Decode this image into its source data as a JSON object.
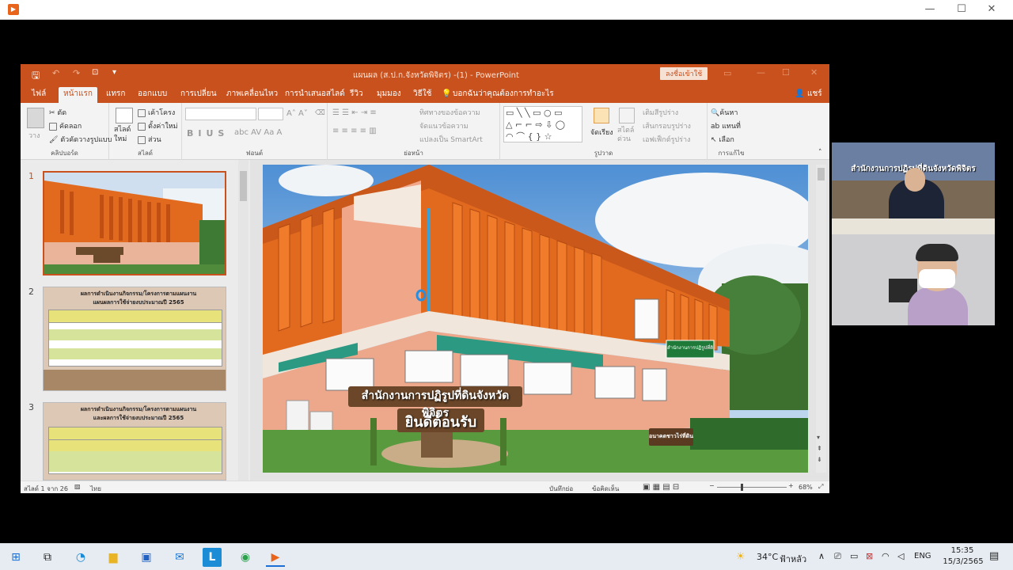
{
  "outer_window": {
    "controls": [
      "—",
      "☐",
      "✕"
    ]
  },
  "ppt": {
    "title": "แผนผล (ส.ป.ก.จังหวัดพิจิตร) -(1) - PowerPoint",
    "signin": "ลงชื่อเข้าใช้",
    "ribbon_tabs": [
      "ไฟล์",
      "หน้าแรก",
      "แทรก",
      "ออกแบบ",
      "การเปลี่ยน",
      "ภาพเคลื่อนไหว",
      "การนำเสนอสไลด์",
      "รีวิว",
      "มุมมอง",
      "วิธีใช้"
    ],
    "tell_me": "บอกฉันว่าคุณต้องการทำอะไร",
    "share": "แชร์",
    "clipboard": {
      "paste": "วาง",
      "cut": "ตัด",
      "copy": "คัดลอก",
      "format_painter": "ตัวคัดวางรูปแบบ",
      "label": "คลิปบอร์ด"
    },
    "slides": {
      "new_slide": "สไลด์ใหม่",
      "layout": "เค้าโครง",
      "reset": "ตั้งค่าใหม่",
      "section": "ส่วน",
      "label": "สไลด์"
    },
    "font": {
      "label": "ฟอนต์"
    },
    "paragraph": {
      "text_direction": "ทิศทางของข้อความ",
      "align_text": "จัดแนวข้อความ",
      "smartart": "แปลงเป็น SmartArt",
      "label": "ย่อหน้า"
    },
    "drawing": {
      "arrange": "จัดเรียง",
      "quick_styles": "สไตล์ด่วน",
      "shape_fill": "เติมสีรูปร่าง",
      "shape_outline": "เส้นกรอบรูปร่าง",
      "shape_effects": "เอฟเฟ็กต์รูปร่าง",
      "label": "รูปวาด"
    },
    "editing": {
      "find": "ค้นหา",
      "replace": "แทนที่",
      "select": "เลือก",
      "label": "การแก้ไข"
    },
    "slide_numbers": [
      "1",
      "2",
      "3"
    ],
    "thumb_titles": {
      "t2a": "ผลการดำเนินงานกิจกรรม/โครงการตามแผนงาน",
      "t2b": "แผนผลการใช้จ่ายงบประมาณปี 2565",
      "t3a": "ผลการดำเนินงานกิจกรรม/โครงการตามแผนงาน",
      "t3b": "และผลการใช้จ่ายงบประมาณปี 2565"
    },
    "slide": {
      "sign_line1": "สำนักงานการปฏิรูปที่ดินจังหวัดพิจิตร",
      "sign_line2": "ยินดีต้อนรับ",
      "building_sign": "สำนักงานการปฏิรูปที่ดินจังหวัดพิจิตร",
      "small_sign": "อนาคตชาวไร่ที่ดิน"
    },
    "status": {
      "slide_of": "สไลด์ 1 จาก 26",
      "lang": "ไทย",
      "notes": "บันทึกย่อ",
      "comments": "ข้อคิดเห็น",
      "zoom": "68%"
    }
  },
  "camera": {
    "banner": "สำนักงานการปฏิรูปที่ดินจังหวัดพิจิตร"
  },
  "taskbar": {
    "weather_temp": "34°C",
    "weather_desc": "ฟ้าหลัว",
    "lang": "ENG",
    "time": "15:35",
    "date": "15/3/2565",
    "app_l": "L"
  },
  "colors": {
    "ppt_orange": "#c9511e",
    "building_orange": "#e26a1f"
  }
}
